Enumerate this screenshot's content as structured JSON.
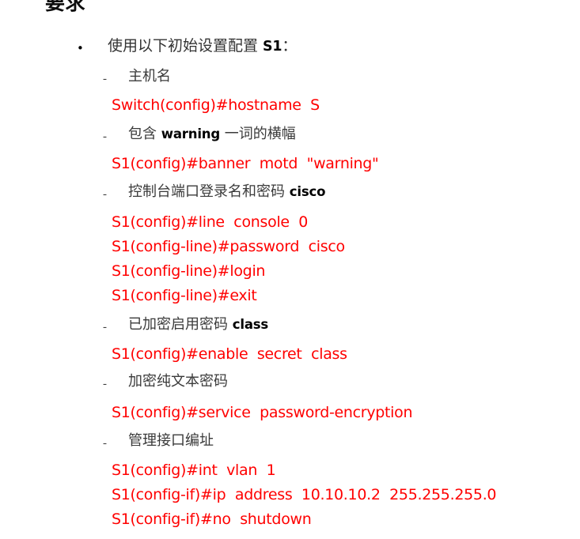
{
  "document": {
    "heading": "要求",
    "background_color": "#ffffff",
    "command_color": "#ff0000",
    "text_color": "#3a3a3a",
    "keyword_color": "#000000"
  },
  "bullet_marker": "•",
  "dash_marker": "-",
  "items": [
    {
      "level": "bullet",
      "text_before": "使用以下初始设置配置 ",
      "keyword": "S1",
      "text_after": "："
    },
    {
      "level": "dash",
      "text_before": "主机名",
      "keyword": "",
      "text_after": ""
    },
    {
      "level": "dash",
      "text_before": "包含 ",
      "keyword": "warning",
      "text_after": " 一词的横幅"
    },
    {
      "level": "dash",
      "text_before": "控制台端口登录名和密码 ",
      "keyword": "cisco",
      "text_after": ""
    },
    {
      "level": "dash",
      "text_before": "已加密启用密码 ",
      "keyword": "class",
      "text_after": ""
    },
    {
      "level": "dash",
      "text_before": "加密纯文本密码",
      "keyword": "",
      "text_after": ""
    },
    {
      "level": "dash",
      "text_before": "管理接口编址",
      "keyword": "",
      "text_after": ""
    }
  ],
  "commands": {
    "hostname": "Switch(config)#hostname  S",
    "banner": "S1(config)#banner  motd  \"warning\"",
    "console_line": "S1(config)#line  console  0",
    "console_password": "S1(config-line)#password  cisco",
    "console_login": "S1(config-line)#login",
    "console_exit": "S1(config-line)#exit",
    "enable_secret": "S1(config)#enable  secret  class",
    "service_password_encryption": "S1(config)#service  password-encryption",
    "int_vlan": "S1(config)#int  vlan  1",
    "ip_address": "S1(config-if)#ip  address  10.10.10.2  255.255.255.0",
    "no_shutdown": "S1(config-if)#no  shutdown"
  }
}
